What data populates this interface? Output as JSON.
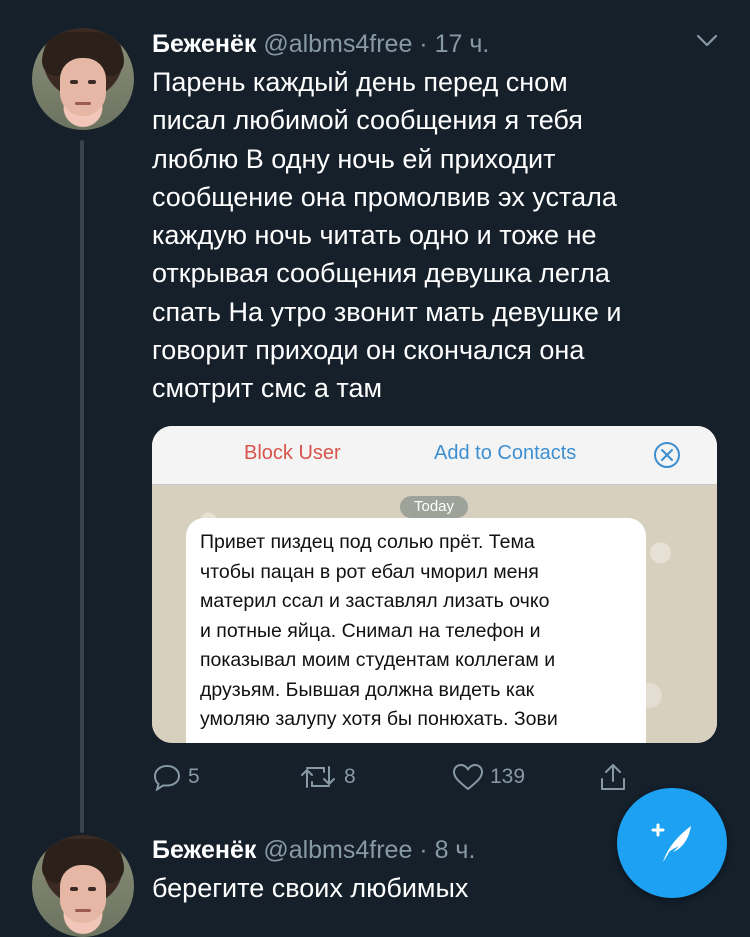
{
  "tweets": [
    {
      "display_name": "Беженёк",
      "handle_time": "@albms4free · 17 ч.",
      "text_lines": [
        "Парень каждый день перед сном",
        "писал любимой сообщения я тебя",
        "люблю В одну ночь ей приходит",
        "сообщение она промолвив эх устала",
        "каждую ночь читать одно и тоже не",
        "открывая сообщения девушка легла",
        "спать На утро звонит мать девушке и",
        "говорит приходи он скончался она",
        "смотрит смс а там"
      ],
      "media": {
        "block_user": "Block User",
        "add_to_contacts": "Add to Contacts",
        "date_badge": "Today",
        "message_lines": [
          "Привет пиздец под солью прёт. Тема",
          "чтобы пацан в рот ебал чморил меня",
          "материл ссал и заставлял лизать очко",
          "и потные яйца. Снимал на телефон и",
          "показывал моим студентам коллегам и",
          "друзьям. Бывшая должна видеть как",
          "умоляю залупу хотя бы понюхать. Зови"
        ]
      },
      "actions": {
        "replies": "5",
        "retweets": "8",
        "likes": "139"
      }
    },
    {
      "display_name": "Беженёк",
      "handle_time": "@albms4free · 8 ч.",
      "text_lines": [
        "берегите своих любимых"
      ]
    }
  ],
  "icons": {
    "reply": "reply-icon",
    "retweet": "retweet-icon",
    "like": "heart-icon",
    "share": "share-icon",
    "compose": "compose-tweet-icon",
    "more": "chevron-down-icon"
  },
  "colors": {
    "background": "#15202b",
    "secondary_text": "#8899a6",
    "accent": "#1da1f2"
  }
}
